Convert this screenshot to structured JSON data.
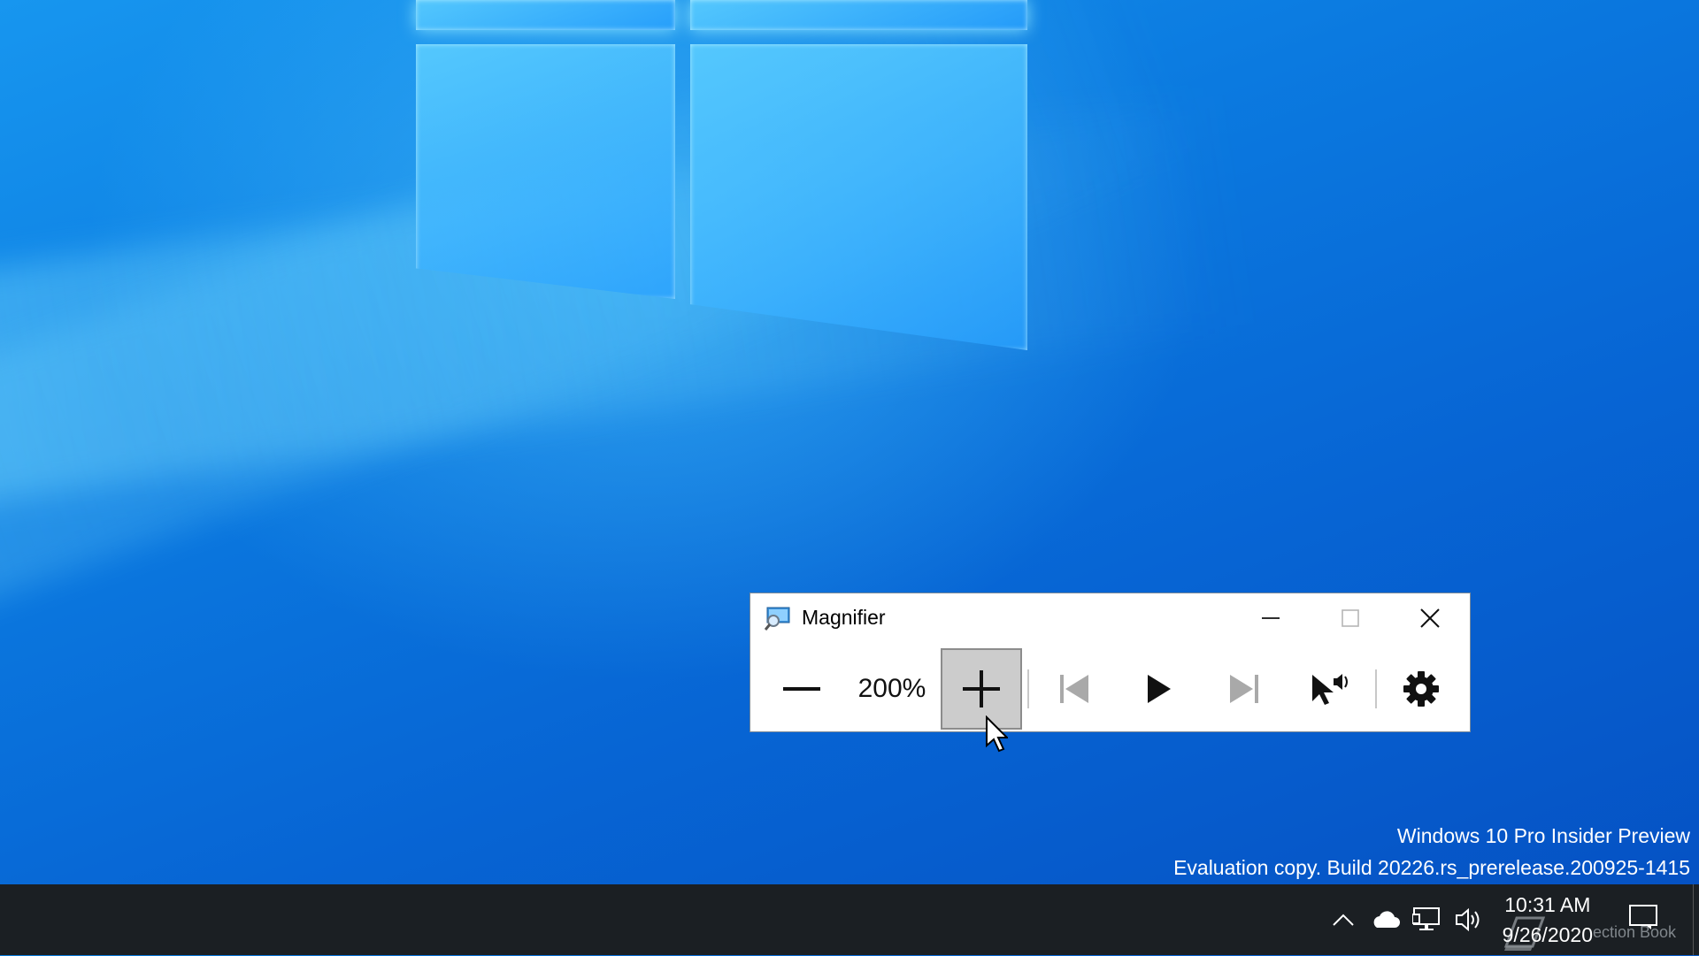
{
  "window": {
    "title": "Magnifier",
    "minimize_icon": "minimize-icon",
    "maximize_icon": "maximize-icon",
    "close_icon": "close-icon"
  },
  "toolbar": {
    "zoom_out_icon": "minus-icon",
    "zoom_level": "200%",
    "zoom_in_icon": "plus-icon",
    "previous_icon": "skip-previous-icon",
    "play_icon": "play-icon",
    "next_icon": "skip-next-icon",
    "read_from_here_icon": "pointer-speaker-icon",
    "settings_icon": "gear-icon"
  },
  "watermark": {
    "line1": "Windows 10 Pro Insider Preview",
    "line2": "Evaluation copy. Build 20226.rs_prerelease.200925-1415"
  },
  "taskbar": {
    "time": "10:31 AM",
    "date": "9/26/2020",
    "overlay_text": "ection Book",
    "tray_icons": [
      "chevron-up-icon",
      "cloud-icon",
      "network-icon",
      "volume-icon"
    ]
  },
  "colors": {
    "desktop_blue": "#0a7fe0",
    "taskbar": "#1b1f23",
    "active_button": "#cccccc"
  }
}
